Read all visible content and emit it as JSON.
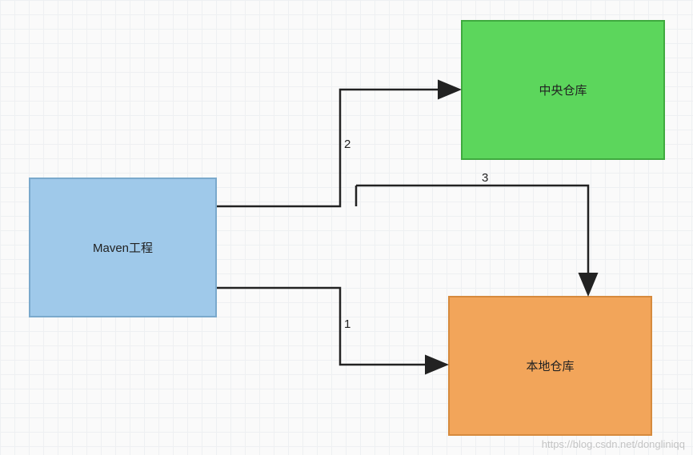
{
  "nodes": {
    "maven": {
      "label": "Maven工程"
    },
    "central": {
      "label": "中央仓库"
    },
    "local": {
      "label": "本地仓库"
    }
  },
  "edges": {
    "to_local": {
      "label": "1"
    },
    "to_central": {
      "label": "2"
    },
    "central_to_local": {
      "label": "3"
    }
  },
  "watermark": "https://blog.csdn.net/dongliniqq"
}
